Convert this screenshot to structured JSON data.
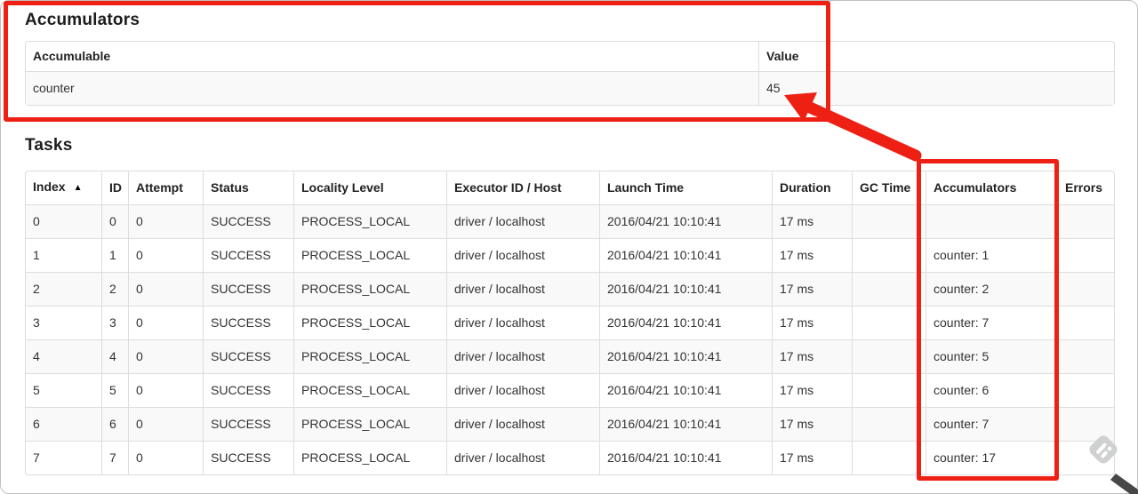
{
  "window": {
    "background_color": "#ffffff",
    "frame_border_color": "#bfbfbf"
  },
  "accumulators_section": {
    "title": "Accumulators",
    "table": {
      "headers": [
        "Accumulable",
        "Value"
      ],
      "rows": [
        {
          "accumulable": "counter",
          "value": "45"
        }
      ]
    }
  },
  "tasks_section": {
    "title": "Tasks",
    "table": {
      "headers": [
        "Index",
        "ID",
        "Attempt",
        "Status",
        "Locality Level",
        "Executor ID / Host",
        "Launch Time",
        "Duration",
        "GC Time",
        "Accumulators",
        "Errors"
      ],
      "sorted_column": "Index",
      "sort_direction": "ascending",
      "rows": [
        [
          "0",
          "0",
          "0",
          "SUCCESS",
          "PROCESS_LOCAL",
          "driver / localhost",
          "2016/04/21 10:10:41",
          "17 ms",
          "",
          "",
          ""
        ],
        [
          "1",
          "1",
          "0",
          "SUCCESS",
          "PROCESS_LOCAL",
          "driver / localhost",
          "2016/04/21 10:10:41",
          "17 ms",
          "",
          "counter: 1",
          ""
        ],
        [
          "2",
          "2",
          "0",
          "SUCCESS",
          "PROCESS_LOCAL",
          "driver / localhost",
          "2016/04/21 10:10:41",
          "17 ms",
          "",
          "counter: 2",
          ""
        ],
        [
          "3",
          "3",
          "0",
          "SUCCESS",
          "PROCESS_LOCAL",
          "driver / localhost",
          "2016/04/21 10:10:41",
          "17 ms",
          "",
          "counter: 7",
          ""
        ],
        [
          "4",
          "4",
          "0",
          "SUCCESS",
          "PROCESS_LOCAL",
          "driver / localhost",
          "2016/04/21 10:10:41",
          "17 ms",
          "",
          "counter: 5",
          ""
        ],
        [
          "5",
          "5",
          "0",
          "SUCCESS",
          "PROCESS_LOCAL",
          "driver / localhost",
          "2016/04/21 10:10:41",
          "17 ms",
          "",
          "counter: 6",
          ""
        ],
        [
          "6",
          "6",
          "0",
          "SUCCESS",
          "PROCESS_LOCAL",
          "driver / localhost",
          "2016/04/21 10:10:41",
          "17 ms",
          "",
          "counter: 7",
          ""
        ],
        [
          "7",
          "7",
          "0",
          "SUCCESS",
          "PROCESS_LOCAL",
          "driver / localhost",
          "2016/04/21 10:10:41",
          "17 ms",
          "",
          "counter: 17",
          ""
        ]
      ]
    }
  },
  "icons": {
    "sort_asc": "▲",
    "watermark": "skitch-watermark",
    "pen_cursor": "pen-cursor"
  },
  "annotations": {
    "color": "#ee2013",
    "highlighted_value": "45",
    "highlighted_column": "Accumulators"
  }
}
